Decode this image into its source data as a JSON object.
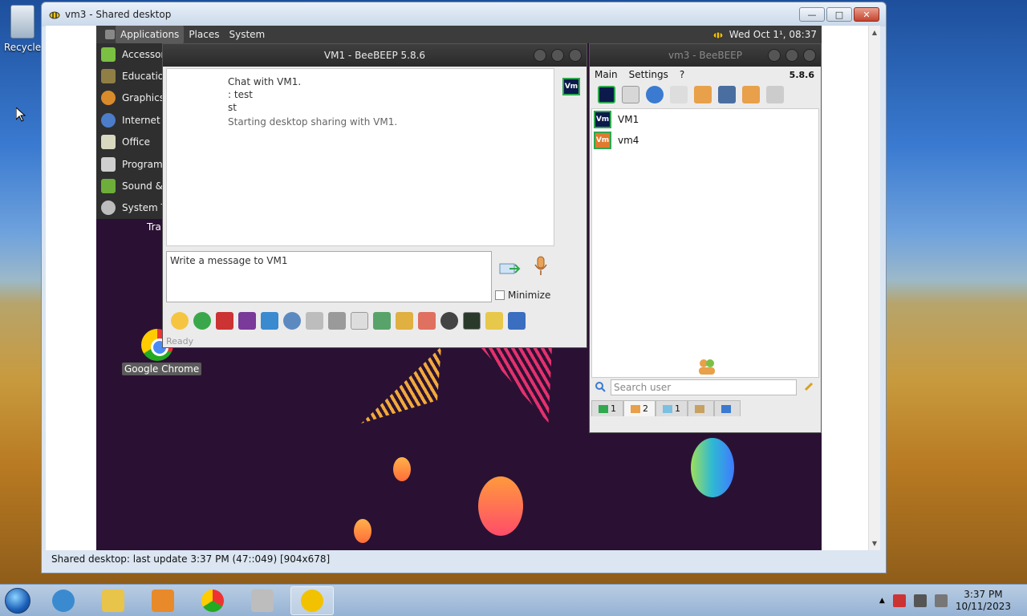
{
  "host": {
    "recycle_bin_label": "Recycle",
    "viewer": {
      "title": "vm3 - Shared desktop",
      "status": "Shared desktop: last update 3:37 PM (47::049) [904x678]"
    }
  },
  "remote": {
    "topbar": {
      "menus": [
        "Applications",
        "Places",
        "System"
      ],
      "clock": "Wed Oct 1¹, 08:37"
    },
    "apps_menu": {
      "items": [
        {
          "label": "Accessories",
          "icon": "accessories-icon",
          "color": "#7bc043"
        },
        {
          "label": "Education",
          "icon": "education-icon",
          "color": "#8f7f45"
        },
        {
          "label": "Graphics",
          "icon": "graphics-icon",
          "color": "#d98b2b"
        },
        {
          "label": "Internet",
          "icon": "internet-icon",
          "color": "#4c7dc9"
        },
        {
          "label": "Office",
          "icon": "office-icon",
          "color": "#d9d9c0"
        },
        {
          "label": "Programming",
          "icon": "programming-icon",
          "color": "#cfcfcf"
        },
        {
          "label": "Sound & Video",
          "icon": "sound-video-icon",
          "color": "#6dae3a"
        },
        {
          "label": "System Tools",
          "icon": "system-tools-icon",
          "color": "#bdbdbd"
        }
      ]
    },
    "desktop": {
      "trash_label": "Tra",
      "chrome_label": "Google Chrome"
    },
    "chat": {
      "title": "VM1 - BeeBEEP 5.8.6",
      "log": [
        "Chat with VM1.",
        ": test",
        "st",
        "Starting desktop sharing with VM1."
      ],
      "avatar": "Vm",
      "input_text": "Write a message to VM1",
      "minimize_label": "Minimize",
      "status": "Ready"
    },
    "users": {
      "title": "vm3 - BeeBEEP",
      "menus": [
        "Main",
        "Settings",
        "?"
      ],
      "version": "5.8.6",
      "list": [
        {
          "name": "VM1",
          "avatar": "Vm",
          "color": "#0b1a4b"
        },
        {
          "name": "vm4",
          "avatar": "Vm",
          "color": "#e07a2f"
        }
      ],
      "search_placeholder": "Search user",
      "tabs": [
        {
          "count": "1",
          "icon": "chat-tab-icon"
        },
        {
          "count": "2",
          "icon": "users-tab-icon"
        },
        {
          "count": "1",
          "icon": "groups-tab-icon"
        },
        {
          "count": "",
          "icon": "network-tab-icon"
        },
        {
          "count": "",
          "icon": "plugins-tab-icon"
        }
      ]
    }
  },
  "taskbar": {
    "time": "3:37 PM",
    "date": "10/11/2023"
  }
}
